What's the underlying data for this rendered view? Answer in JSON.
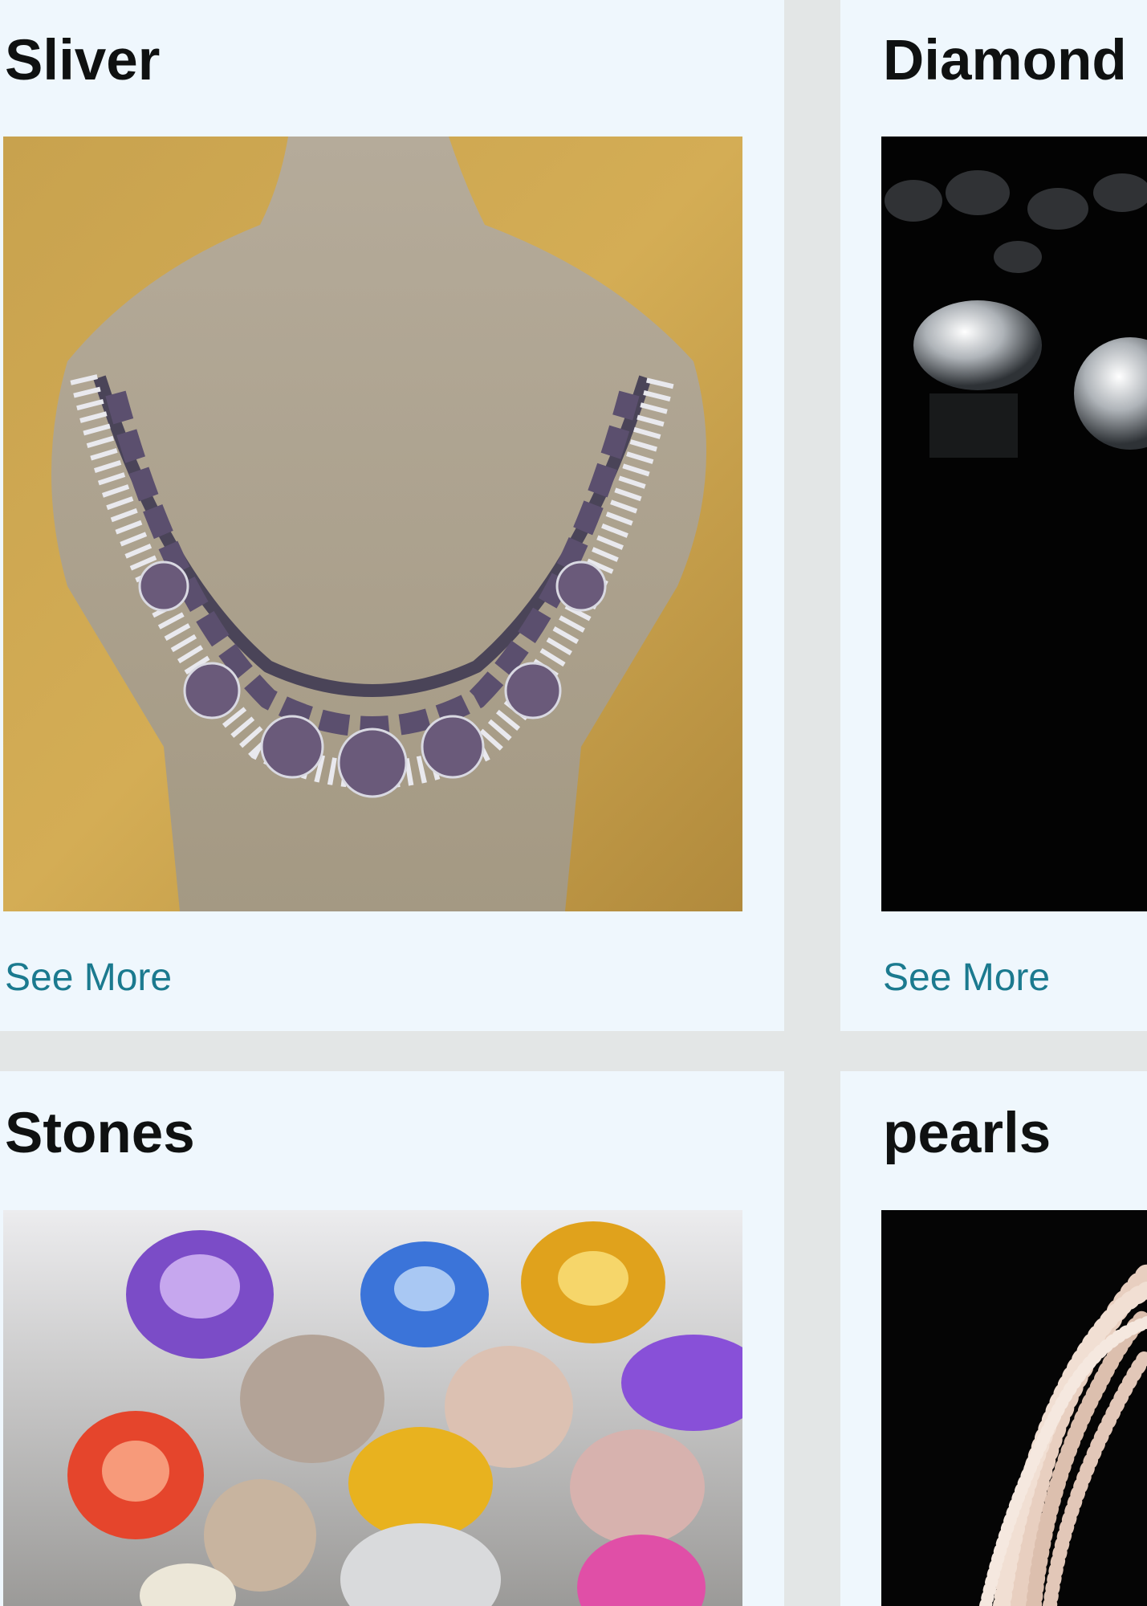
{
  "cards": [
    {
      "title": "Sliver",
      "link": "See More",
      "image": "silver-necklace-on-bust"
    },
    {
      "title": "Diamond",
      "link": "See More",
      "image": "diamonds-on-black"
    },
    {
      "title": "Stones",
      "link": "",
      "image": "colored-gemstones"
    },
    {
      "title": "pearls",
      "link": "",
      "image": "pearl-strands-on-black"
    }
  ],
  "colors": {
    "page_background": "#e3e6e6",
    "card_background": "#eff7fd",
    "title": "#0f1111",
    "link": "#1b7a8f"
  }
}
